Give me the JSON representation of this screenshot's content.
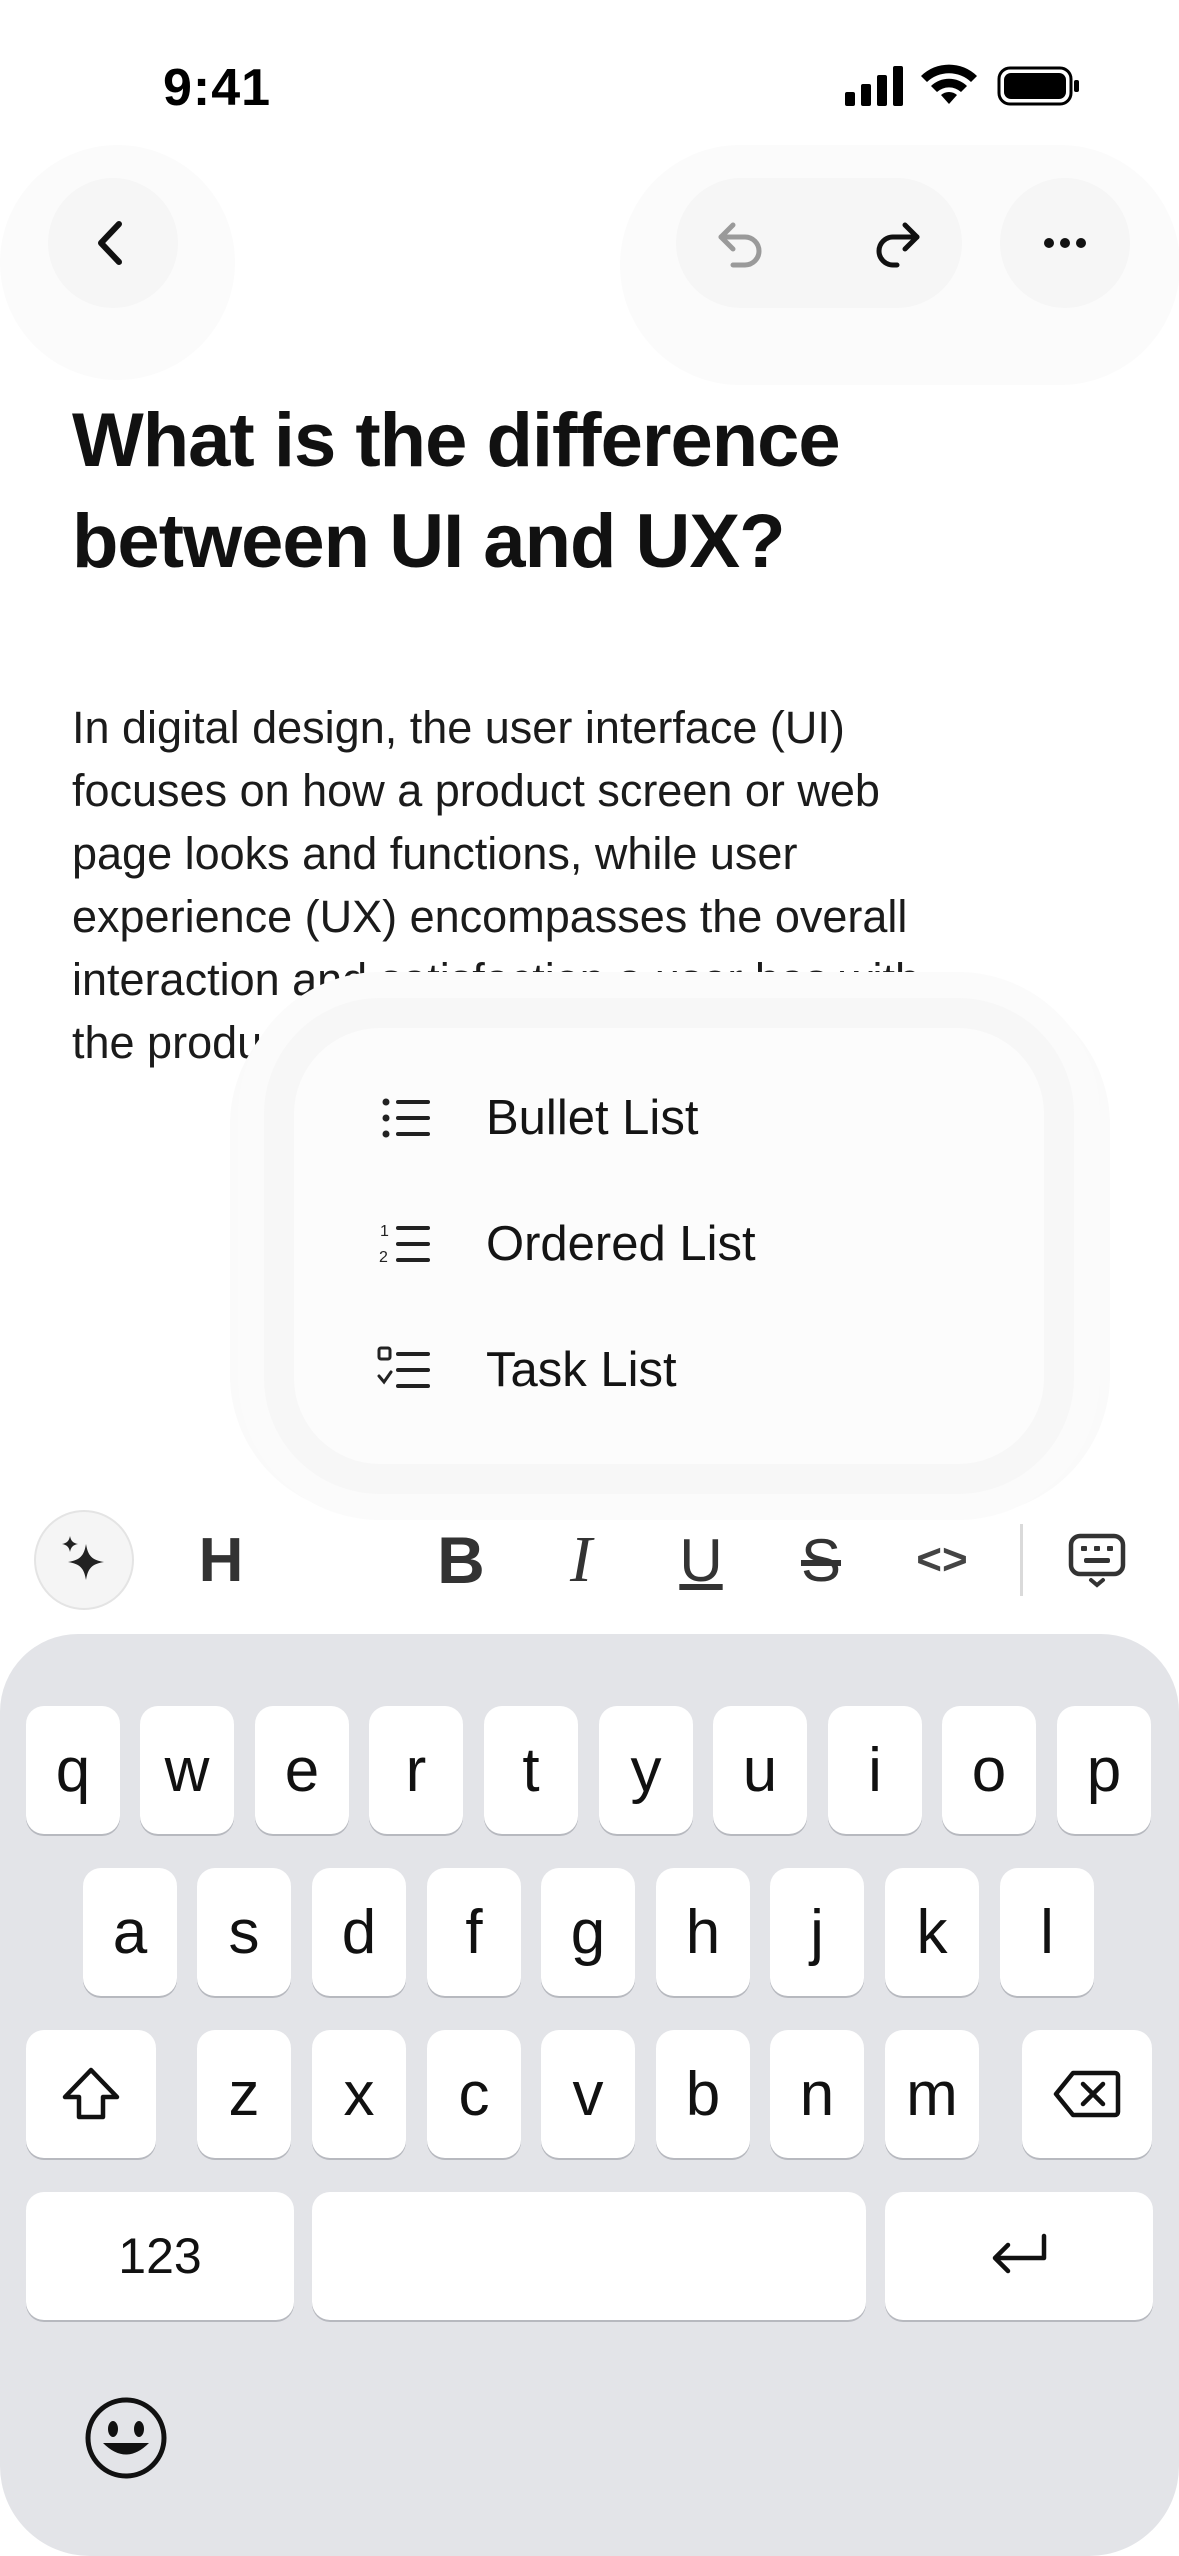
{
  "status_bar": {
    "time": "9:41"
  },
  "header": {
    "back_icon": "chevron-left-icon",
    "undo_icon": "undo-icon",
    "redo_icon": "redo-icon",
    "more_icon": "ellipsis-icon"
  },
  "document": {
    "title_line1": "What is the difference",
    "title_line2": "between UI and UX?",
    "body_lines": [
      "In digital design, the user interface (UI)",
      "focuses on how a product screen or web",
      "page looks and functions, while user",
      "experience (UX) encompasses the overall",
      "interaction and satisfaction a user has with",
      "the product"
    ]
  },
  "list_menu": {
    "items": [
      {
        "label": "Bullet List",
        "icon": "bullet-list-icon"
      },
      {
        "label": "Ordered List",
        "icon": "ordered-list-icon"
      },
      {
        "label": "Task List",
        "icon": "task-list-icon"
      }
    ]
  },
  "format_toolbar": {
    "heading_label": "H",
    "bold_label": "B",
    "italic_label": "I",
    "underline_label": "U",
    "strike_label": "S",
    "code_label": "<>"
  },
  "keyboard": {
    "row1": [
      "q",
      "w",
      "e",
      "r",
      "t",
      "y",
      "u",
      "i",
      "o",
      "p"
    ],
    "row2": [
      "a",
      "s",
      "d",
      "f",
      "g",
      "h",
      "j",
      "k",
      "l"
    ],
    "row3": [
      "z",
      "x",
      "c",
      "v",
      "b",
      "n",
      "m"
    ],
    "numbers_label": "123"
  },
  "colors": {
    "accent": "#111111",
    "keyboard_bg": "#e3e4e8"
  }
}
